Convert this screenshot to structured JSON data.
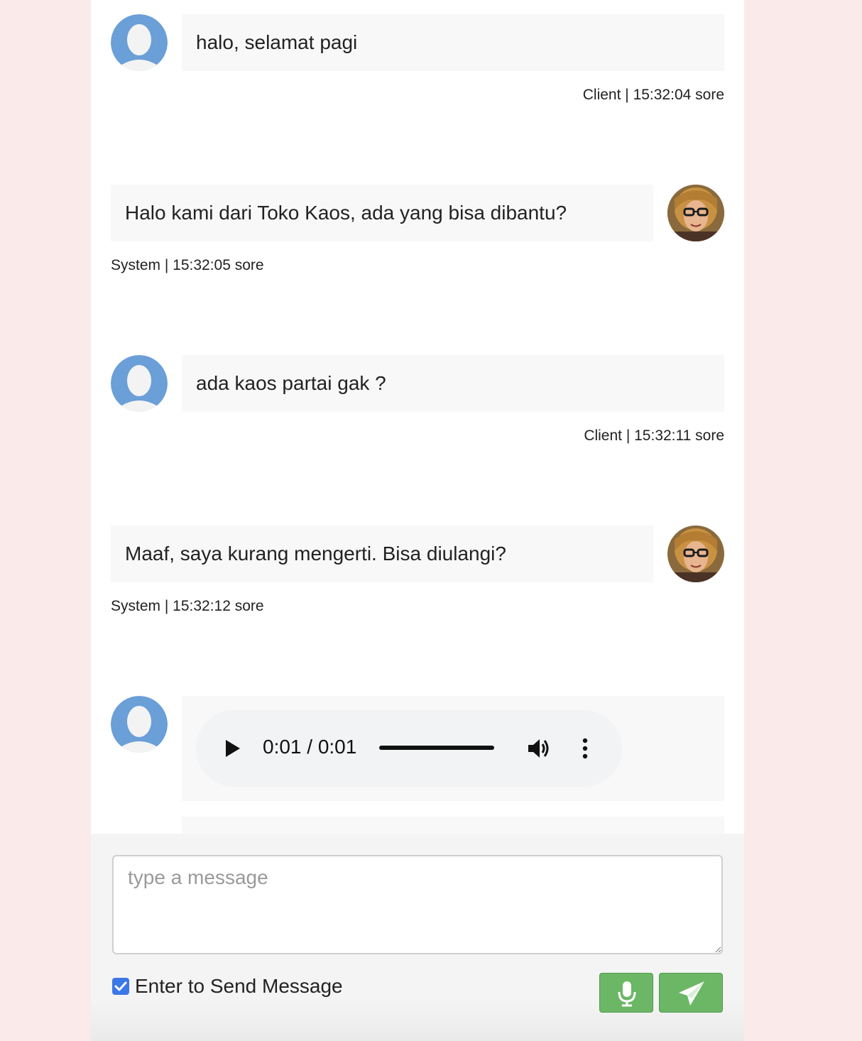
{
  "messages": [
    {
      "role": "client",
      "text": "halo, selamat pagi",
      "meta": "Client | 15:32:04 sore"
    },
    {
      "role": "system",
      "text": "Halo kami dari Toko Kaos, ada yang bisa dibantu?",
      "meta": "System | 15:32:05 sore"
    },
    {
      "role": "client",
      "text": "ada kaos partai gak ?",
      "meta": "Client | 15:32:11 sore"
    },
    {
      "role": "system",
      "text": "Maaf, saya kurang mengerti. Bisa diulangi?",
      "meta": "System | 15:32:12 sore"
    }
  ],
  "audio": {
    "time": "0:01 / 0:01",
    "progress": 1.0
  },
  "composer": {
    "placeholder": "type a message",
    "enter_to_send_label": "Enter to Send Message",
    "enter_to_send_checked": true
  },
  "icons": {
    "client_avatar": "user-silhouette-icon",
    "system_avatar": "woman-photo-avatar",
    "mic": "microphone-icon",
    "send": "paper-plane-icon",
    "play": "play-icon",
    "volume": "volume-icon",
    "more": "vertical-dots-icon"
  },
  "colors": {
    "page_background": "#fbeaea",
    "bubble_background": "#f9f8f8",
    "client_avatar": "#6a9fd8",
    "button_green": "#6cb766",
    "checkbox_blue": "#3b78e7"
  }
}
